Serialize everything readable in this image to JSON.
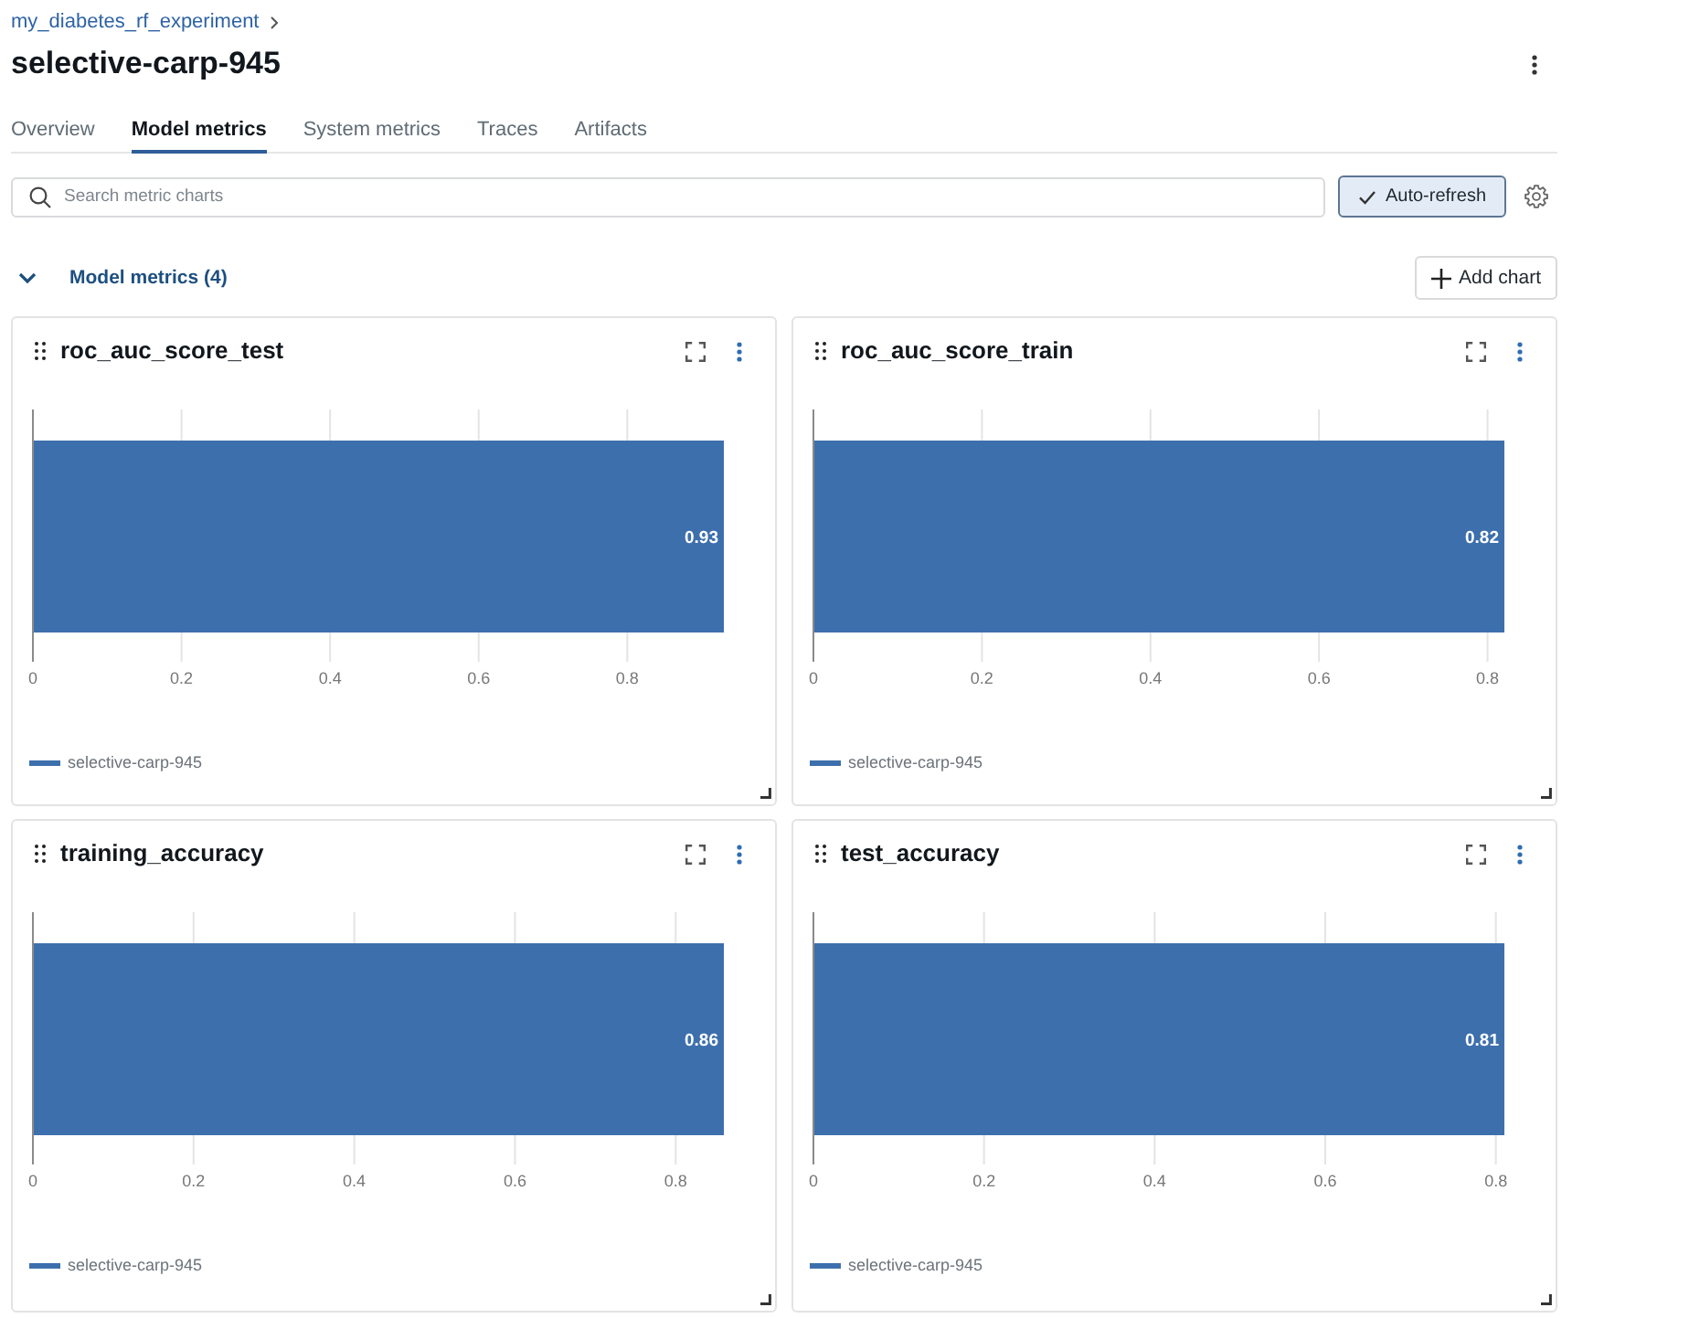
{
  "breadcrumb": "my_diabetes_rf_experiment",
  "run_title": "selective-carp-945",
  "tabs": [
    {
      "label": "Overview",
      "selected": false
    },
    {
      "label": "Model metrics",
      "selected": true
    },
    {
      "label": "System metrics",
      "selected": false
    },
    {
      "label": "Traces",
      "selected": false
    },
    {
      "label": "Artifacts",
      "selected": false
    }
  ],
  "search": {
    "placeholder": "Search metric charts"
  },
  "auto_refresh": {
    "label": "Auto-refresh",
    "checked": true
  },
  "section": {
    "title": "Model metrics (4)",
    "expanded": true,
    "add_button": "Add chart"
  },
  "charts": [
    {
      "title": "roc_auc_score_test",
      "chart_data": {
        "type": "bar",
        "orientation": "horizontal",
        "series": [
          {
            "name": "selective-carp-945",
            "color": "#3d6fad",
            "values": [
              0.93
            ]
          }
        ],
        "xlim": [
          0,
          0.93
        ],
        "xticks": [
          0,
          0.2,
          0.4,
          0.6,
          0.8
        ],
        "grid": true,
        "value_labels": [
          "0.93"
        ]
      }
    },
    {
      "title": "roc_auc_score_train",
      "chart_data": {
        "type": "bar",
        "orientation": "horizontal",
        "series": [
          {
            "name": "selective-carp-945",
            "color": "#3d6fad",
            "values": [
              0.82
            ]
          }
        ],
        "xlim": [
          0,
          0.82
        ],
        "xticks": [
          0,
          0.2,
          0.4,
          0.6,
          0.8
        ],
        "grid": true,
        "value_labels": [
          "0.82"
        ]
      }
    },
    {
      "title": "training_accuracy",
      "chart_data": {
        "type": "bar",
        "orientation": "horizontal",
        "series": [
          {
            "name": "selective-carp-945",
            "color": "#3d6fad",
            "values": [
              0.86
            ]
          }
        ],
        "xlim": [
          0,
          0.86
        ],
        "xticks": [
          0,
          0.2,
          0.4,
          0.6,
          0.8
        ],
        "grid": true,
        "value_labels": [
          "0.86"
        ]
      }
    },
    {
      "title": "test_accuracy",
      "chart_data": {
        "type": "bar",
        "orientation": "horizontal",
        "series": [
          {
            "name": "selective-carp-945",
            "color": "#3d6fad",
            "values": [
              0.81
            ]
          }
        ],
        "xlim": [
          0,
          0.81
        ],
        "xticks": [
          0,
          0.2,
          0.4,
          0.6,
          0.8
        ],
        "grid": true,
        "value_labels": [
          "0.81"
        ]
      }
    }
  ]
}
